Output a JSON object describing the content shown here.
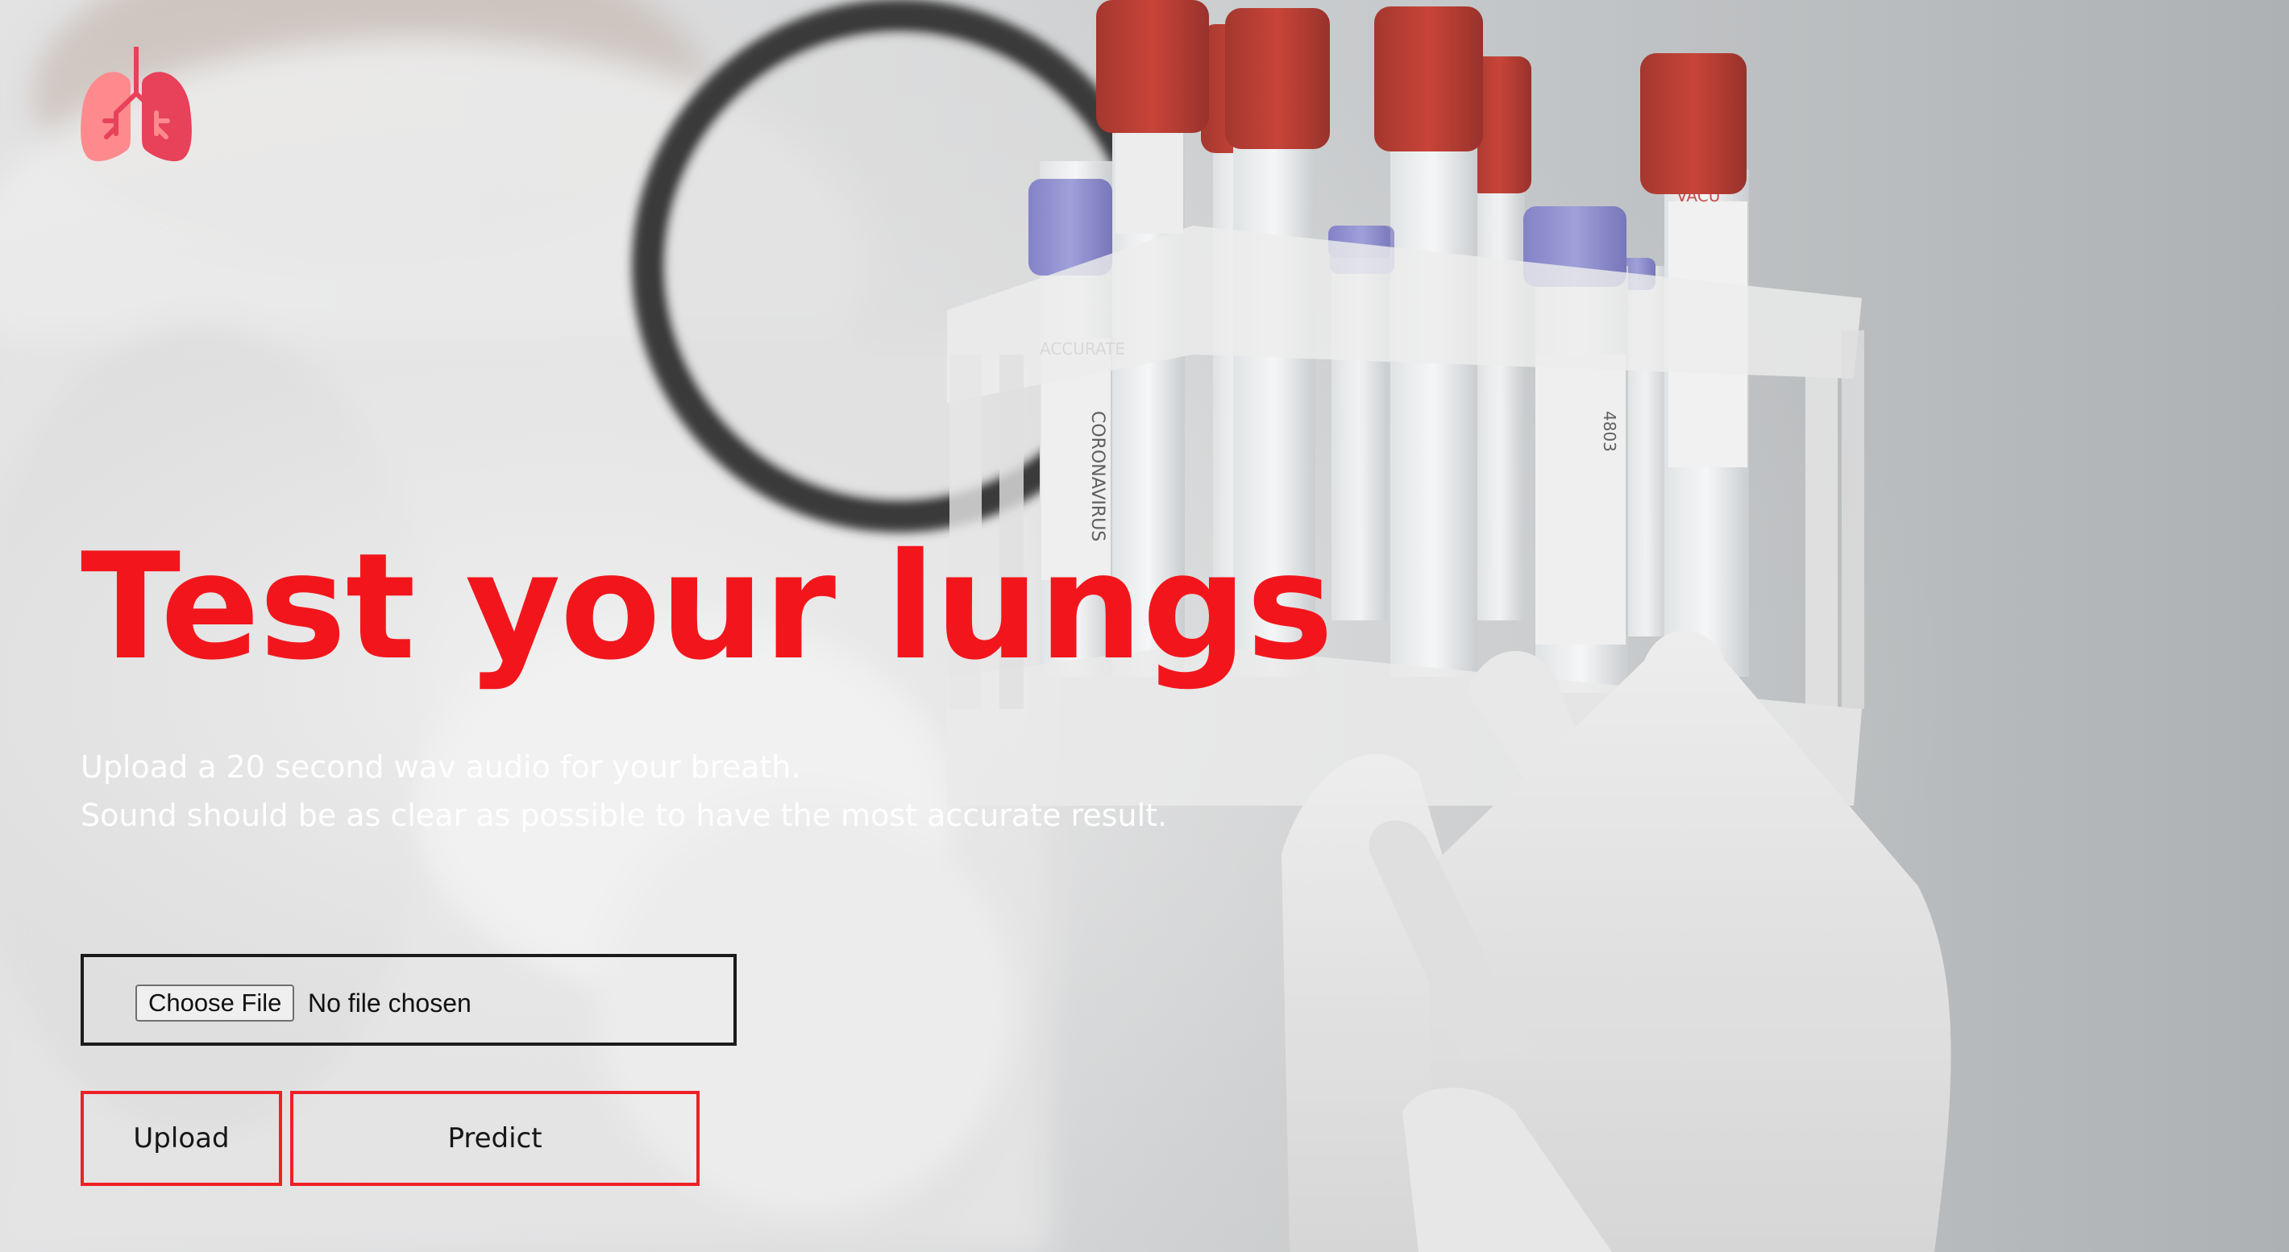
{
  "app": {
    "logo_icon": "lungs-icon",
    "brand_colors": {
      "accent": "#f2161c",
      "logo_light": "#ff8a8d",
      "logo_dark": "#e8415a"
    }
  },
  "hero": {
    "title": "Test your lungs",
    "subtitle_line1": "Upload a 20 second wav audio for your breath.",
    "subtitle_line2": "Sound should be as clear as possible to have the most accurate result."
  },
  "file_input": {
    "button_label": "Choose File",
    "status": "No file chosen"
  },
  "actions": {
    "upload_label": "Upload",
    "predict_label": "Predict"
  }
}
